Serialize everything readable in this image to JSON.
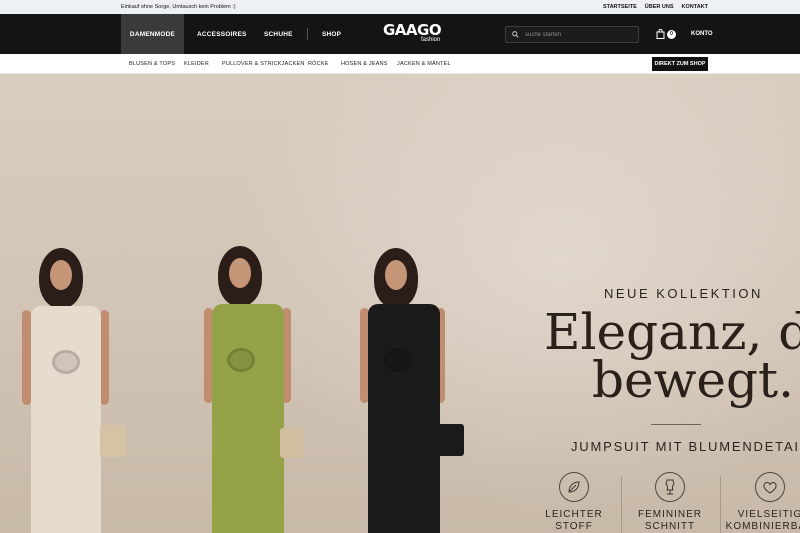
{
  "topbar": {
    "notice": "Einkauf ohne Sorge, Umtausch kein Problem :)",
    "links": [
      "STARTSEITE",
      "ÜBER UNS",
      "KONTAKT"
    ]
  },
  "mainnav": {
    "items": [
      "DAMENMODE",
      "ACCESSOIRES",
      "SCHUHE",
      "SHOP"
    ],
    "logo": "GAAGO",
    "logo_sub": "fashion",
    "search_placeholder": "suche starten",
    "cart_count": "0",
    "account": "KONTO"
  },
  "subnav": {
    "items": [
      "BLUSEN & TOPS",
      "KLEIDER",
      "PULLOVER & STRICKJACKEN",
      "RÖCKE",
      "HOSEN & JEANS",
      "JACKEN & MÄNTEL"
    ],
    "cta": "DIREKT ZUM SHOP"
  },
  "hero": {
    "eyebrow": "NEUE KOLLEKTION",
    "headline_line1": "Eleganz, die",
    "headline_line2": "bewegt.",
    "subtitle": "JUMPSUIT MIT BLUMENDETAIL",
    "features": [
      {
        "icon": "leaf-icon",
        "line1": "LEICHTER",
        "line2": "STOFF"
      },
      {
        "icon": "dress-form-icon",
        "line1": "FEMININER",
        "line2": "SCHNITT"
      },
      {
        "icon": "heart-icon",
        "line1": "VIELSEITIG",
        "line2": "KOMBINIERBAR"
      }
    ],
    "model_colors": [
      "#e6dccd",
      "#95a247",
      "#1b1a1a"
    ]
  }
}
